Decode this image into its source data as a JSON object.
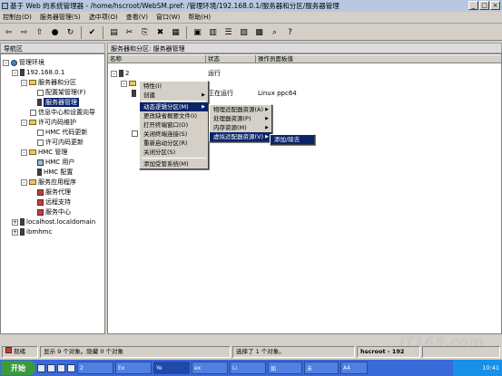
{
  "window": {
    "title": "基于 Web 的系统管理器 - /home/hscroot/WebSM.pref: /管理环境/192.168.0.1/服务器和分区/服务器管理"
  },
  "menubar": [
    "控制台(D)",
    "服务器管理(S)",
    "选中项(O)",
    "查看(V)",
    "窗口(W)",
    "帮助(H)"
  ],
  "nav": {
    "header": "导航区",
    "items": [
      "管理环境",
      "192.168.0.1",
      "服务器和分区",
      "配置架管理(F)",
      "服务器管理",
      "信息中心和设置向导",
      "许可内码维护",
      "HMC 代码更新",
      "许可内码更新",
      "HMC 管理",
      "HMC 用户",
      "HMC 配置",
      "服务应用程序",
      "服务代理",
      "远程支持",
      "服务中心",
      "localhost.localdomain",
      "ibmhmc"
    ]
  },
  "main": {
    "header": "服务器和分区: 服务器管理",
    "columns": [
      "名称",
      "状态",
      "操作员面板值"
    ],
    "rows": [
      {
        "name": "2",
        "status": "运行",
        "panel": ""
      },
      {
        "name": "",
        "status": "正在运行",
        "panel": "Linux ppc64"
      }
    ]
  },
  "context_menu": [
    "特性(I)",
    "创建",
    "动态逻辑分区(M)",
    "更改缺省概要文件(I)",
    "打开终端窗口(O)",
    "关闭终端连接(S)",
    "重新启动分区(R)",
    "关闭分区(S)",
    "添加受管系统(M)"
  ],
  "submenu1": [
    "物理适配器资源(A)",
    "处理器资源(P)",
    "内存资源(M)",
    "虚拟适配器资源(V)"
  ],
  "submenu2": [
    "添加/除去"
  ],
  "status": {
    "ready": "就绪",
    "shown": "显示 9 个对象。隐藏 0 个对象",
    "selected": "选择了 1 个对象。",
    "user": "hscroot - 192"
  },
  "taskbar": {
    "start": "开始",
    "tasks": [
      "2",
      "Ex",
      "Ye",
      "ex",
      "Li",
      "如",
      "未",
      "A4"
    ],
    "clock": "10:41"
  },
  "watermark": "IT168.com"
}
